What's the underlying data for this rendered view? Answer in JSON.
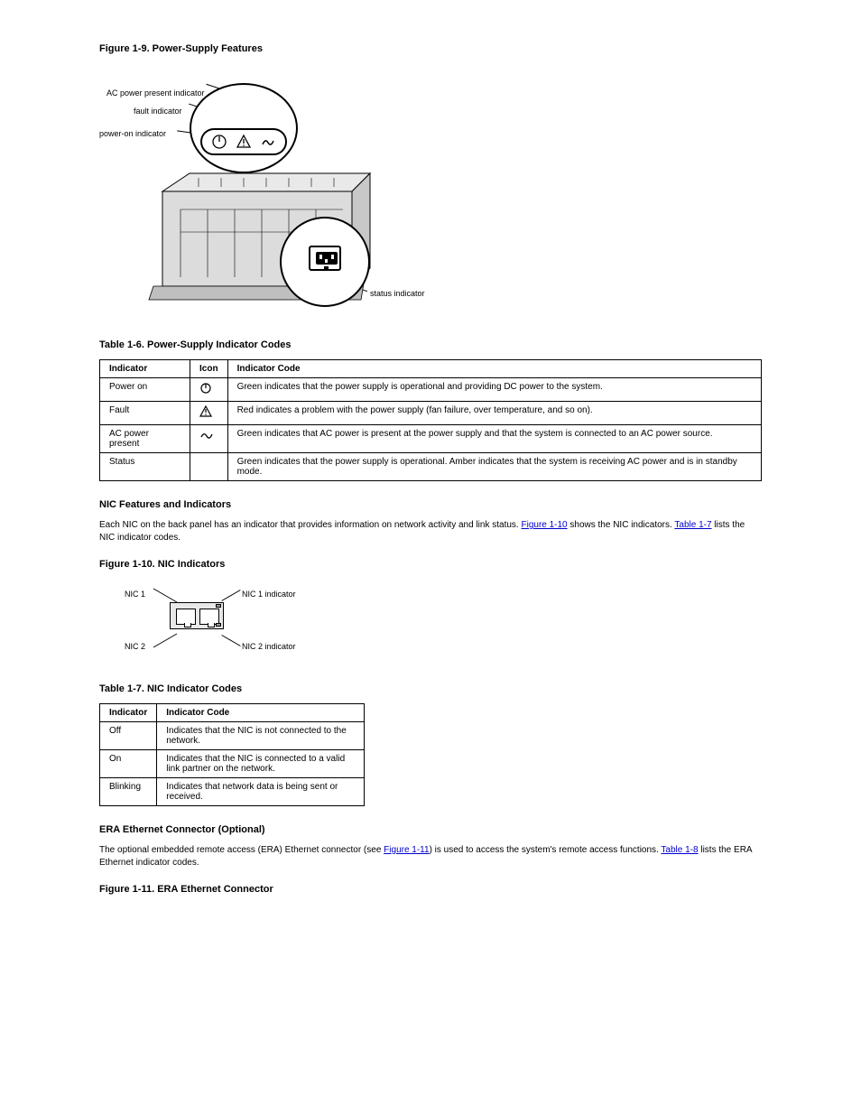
{
  "fig19": {
    "title": "Figure 1-9. Power-Supply Features",
    "callouts": {
      "ac": "AC power present indicator",
      "fault": "fault indicator",
      "poweron": "power-on indicator",
      "status": "status indicator"
    }
  },
  "table16": {
    "title": "Table 1-6. Power-Supply Indicator Codes",
    "headers": [
      "Indicator",
      "Icon",
      "Indicator Code"
    ],
    "rows": [
      [
        "Power on",
        "",
        "Green indicates that the power supply is operational and providing DC power to the system."
      ],
      [
        "Fault",
        "",
        "Red indicates a problem with the power supply (fan failure, over temperature, and so on)."
      ],
      [
        "AC power present",
        "",
        "Green indicates that AC power is present at the power supply and that the system is connected to an AC power source."
      ],
      [
        "Status",
        "",
        "Green indicates that the power supply is operational. Amber indicates that the system is receiving AC power and is in standby mode."
      ]
    ]
  },
  "nic_section": {
    "heading": "NIC Features and Indicators",
    "para_before": "Each NIC on the back panel has an indicator that provides information on network activity and link status. ",
    "fig_link": "Figure 1-10",
    "para_mid": " shows the NIC indicators. ",
    "tbl_link": "Table 1-7",
    "para_after": " lists the NIC indicator codes."
  },
  "fig110": {
    "title": "Figure 1-10. NIC Indicators",
    "labels": {
      "nic1": "NIC 1",
      "nic2": "NIC 2",
      "nic1_ind": "NIC 1 indicator",
      "nic2_ind": "NIC 2 indicator"
    }
  },
  "table17": {
    "title": "Table 1-7. NIC Indicator Codes",
    "headers": [
      "Indicator",
      "Indicator Code"
    ],
    "rows": [
      [
        "Off",
        "Indicates that the NIC is not connected to the network."
      ],
      [
        "On",
        "Indicates that the NIC is connected to a valid link partner on the network."
      ],
      [
        "Blinking",
        "Indicates that network data is being sent or received."
      ]
    ]
  },
  "era_section": {
    "heading": "ERA Ethernet Connector (Optional)",
    "para_before": "The optional embedded remote access (ERA) Ethernet connector (see ",
    "fig_link": "Figure 1-11",
    "para_mid": ") is used to access the system's remote access functions. ",
    "tbl_link": "Table 1-8",
    "para_after": " lists the ERA Ethernet indicator codes."
  },
  "fig111": {
    "title": "Figure 1-11. ERA Ethernet Connector"
  }
}
